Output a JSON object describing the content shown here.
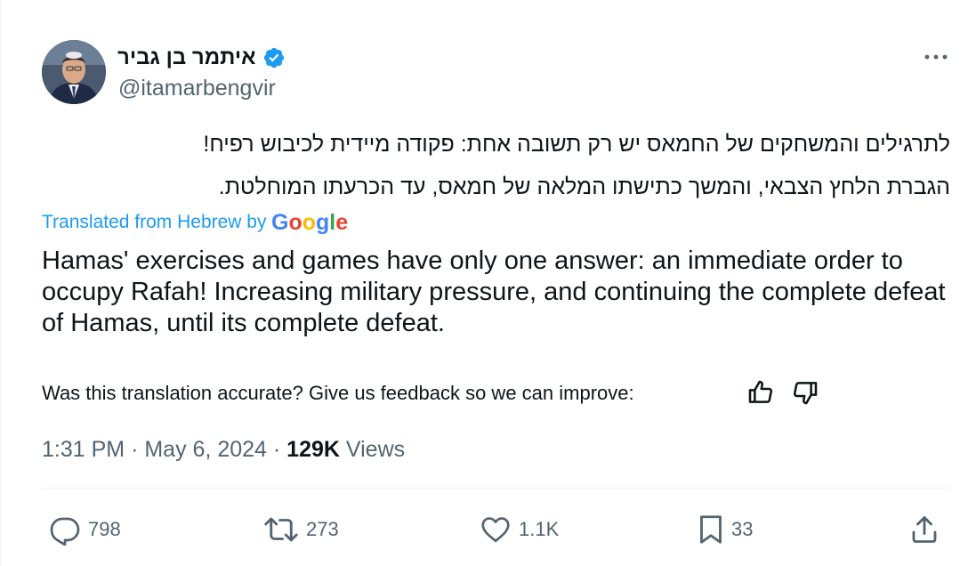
{
  "author": {
    "display_name": "איתמר בן גביר",
    "handle": "@itamarbengvir",
    "verified": true
  },
  "tweet": {
    "hebrew_lines": [
      "לתרגילים והמשחקים של החמאס יש רק תשובה אחת: פקודה מיידית לכיבוש רפיח!",
      "הגברת הלחץ הצבאי, והמשך כתישתו המלאה של חמאס, עד הכרעתו המוחלטת."
    ],
    "translated_from": "Translated from Hebrew by",
    "translation_provider": "Google",
    "translation": "Hamas' exercises and games have only one answer: an immediate order to occupy Rafah! Increasing military pressure, and continuing the complete defeat of Hamas, until its complete defeat."
  },
  "feedback": {
    "prompt": "Was this translation accurate? Give us feedback so we can improve:"
  },
  "meta": {
    "time": "1:31 PM",
    "separator": "·",
    "date": "May 6, 2024",
    "views_count": "129K",
    "views_label": "Views"
  },
  "actions": {
    "replies": "798",
    "reposts": "273",
    "likes": "1.1K",
    "bookmarks": "33"
  },
  "colors": {
    "accent": "#1d9bf0",
    "text": "#0f1419",
    "secondary": "#536471"
  },
  "icons": [
    "verified-badge-icon",
    "more-icon",
    "google-logo",
    "thumbs-up-icon",
    "thumbs-down-icon",
    "reply-icon",
    "repost-icon",
    "like-icon",
    "bookmark-icon",
    "share-icon"
  ]
}
